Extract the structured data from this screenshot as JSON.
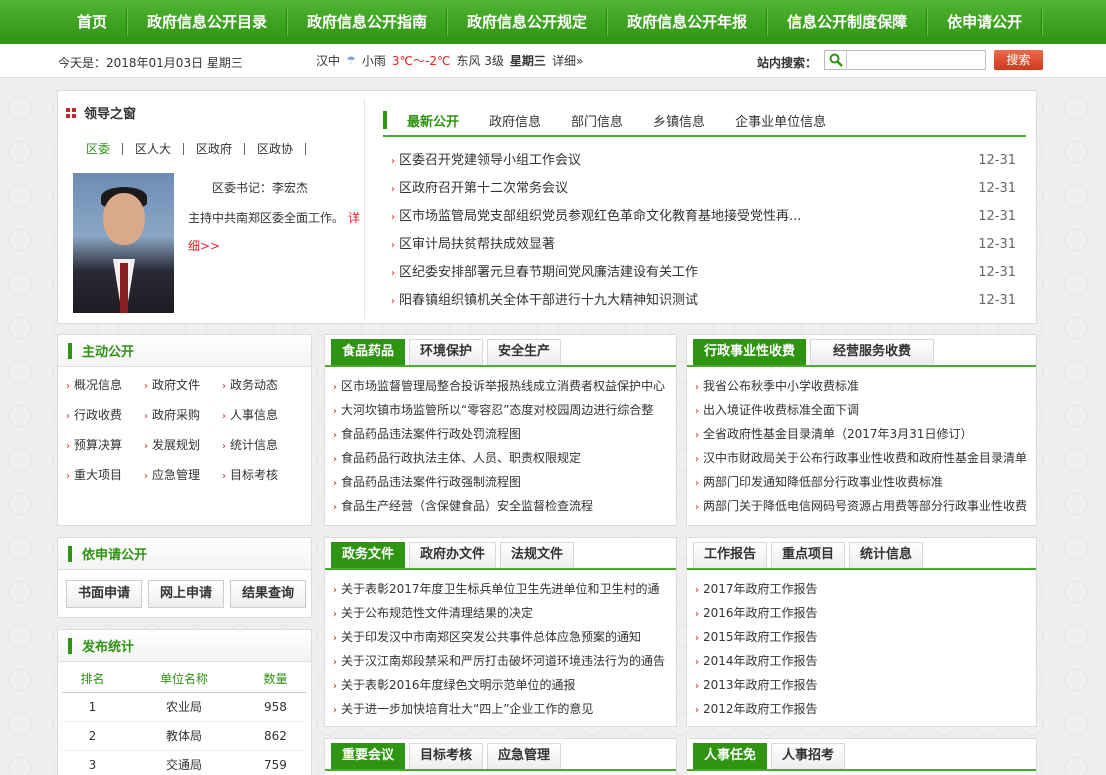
{
  "nav": [
    "首页",
    "政府信息公开目录",
    "政府信息公开指南",
    "政府信息公开规定",
    "政府信息公开年报",
    "信息公开制度保障",
    "依申请公开"
  ],
  "infobar": {
    "date": "今天是：2018年01月03日 星期三",
    "city": "汉中",
    "weather": "小雨",
    "temp": "3℃～-2℃",
    "wind": "东风  3级",
    "weekday": "星期三",
    "detail": "详细»",
    "search_label": "站内搜索：",
    "search_button": "搜索"
  },
  "leader": {
    "title": "领导之窗",
    "tabs": [
      "区委",
      "区人大",
      "区政府",
      "区政协"
    ],
    "name": "区委书记：李宏杰",
    "desc": "主持中共南郑区委全面工作。",
    "more": "详细>>"
  },
  "news": {
    "tabs": [
      "最新公开",
      "政府信息",
      "部门信息",
      "乡镇信息",
      "企事业单位信息"
    ],
    "items": [
      {
        "title": "区委召开党建领导小组工作会议",
        "date": "12-31"
      },
      {
        "title": "区政府召开第十二次常务会议",
        "date": "12-31"
      },
      {
        "title": "区市场监管局党支部组织党员参观红色革命文化教育基地接受党性再...",
        "date": "12-31"
      },
      {
        "title": "区审计局扶贫帮扶成效显著",
        "date": "12-31"
      },
      {
        "title": "区纪委安排部署元旦春节期间党风廉洁建设有关工作",
        "date": "12-31"
      },
      {
        "title": "阳春镇组织镇机关全体干部进行十九大精神知识测试",
        "date": "12-31"
      }
    ]
  },
  "zhudong": {
    "title": "主动公开",
    "items": [
      "概况信息",
      "政府文件",
      "政务动态",
      "行政收费",
      "政府采购",
      "人事信息",
      "预算决算",
      "发展规划",
      "统计信息",
      "重大项目",
      "应急管理",
      "目标考核"
    ]
  },
  "yishen": {
    "title": "依申请公开",
    "buttons": [
      "书面申请",
      "网上申请",
      "结果查询"
    ]
  },
  "fabu": {
    "title": "发布统计",
    "headers": [
      "排名",
      "单位名称",
      "数量"
    ],
    "rows": [
      [
        "1",
        "农业局",
        "958"
      ],
      [
        "2",
        "教体局",
        "862"
      ],
      [
        "3",
        "交通局",
        "759"
      ]
    ]
  },
  "box1": {
    "tabs": [
      "食品药品",
      "环境保护",
      "安全生产"
    ],
    "items": [
      "区市场监督管理局整合投诉举报热线成立消费者权益保护中心",
      "大河坎镇市场监管所以“零容忍”态度对校园周边进行综合整",
      "食品药品违法案件行政处罚流程图",
      "食品药品行政执法主体、人员、职责权限规定",
      "食品药品违法案件行政强制流程图",
      "食品生产经营（含保健食品）安全监督检查流程"
    ]
  },
  "box2": {
    "tabs": [
      "行政事业性收费",
      "经营服务收费"
    ],
    "items": [
      "我省公布秋季中小学收费标准",
      "出入境证件收费标准全面下调",
      "全省政府性基金目录清单（2017年3月31日修订）",
      "汉中市财政局关于公布行政事业性收费和政府性基金目录清单",
      "两部门印发通知降低部分行政事业性收费标准",
      "两部门关于降低电信网码号资源占用费等部分行政事业性收费"
    ]
  },
  "box3": {
    "tabs": [
      "政务文件",
      "政府办文件",
      "法规文件"
    ],
    "items": [
      "关于表彰2017年度卫生标兵单位卫生先进单位和卫生村的通",
      "关于公布规范性文件清理结果的决定",
      "关于印发汉中市南郑区突发公共事件总体应急预案的通知",
      "关于汉江南郑段禁采和严厉打击破坏河道环境违法行为的通告",
      "关于表彰2016年度绿色文明示范单位的通报",
      "关于进一步加快培育壮大“四上”企业工作的意见"
    ]
  },
  "box4": {
    "tabs": [
      "工作报告",
      "重点项目",
      "统计信息"
    ],
    "items": [
      "2017年政府工作报告",
      "2016年政府工作报告",
      "2015年政府工作报告",
      "2014年政府工作报告",
      "2013年政府工作报告",
      "2012年政府工作报告"
    ]
  },
  "box5": {
    "tabs": [
      "重要会议",
      "目标考核",
      "应急管理"
    ]
  },
  "box6": {
    "tabs": [
      "人事任免",
      "人事招考"
    ]
  },
  "colors": {
    "green": "#2e9412",
    "red": "#d22"
  }
}
